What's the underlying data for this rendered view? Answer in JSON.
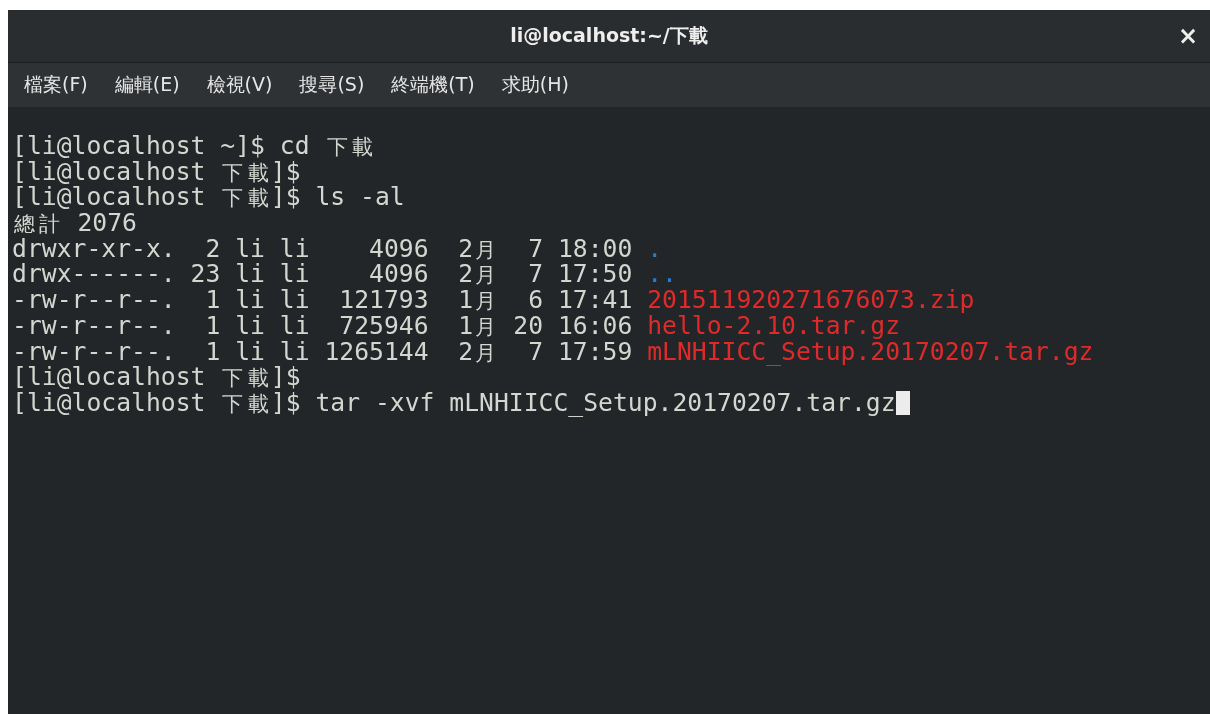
{
  "window": {
    "title": "li@localhost:~/下載",
    "close": "×"
  },
  "menu": [
    {
      "label": "檔案(F)"
    },
    {
      "label": "編輯(E)"
    },
    {
      "label": "檢視(V)"
    },
    {
      "label": "搜尋(S)"
    },
    {
      "label": "終端機(T)"
    },
    {
      "label": "求助(H)"
    }
  ],
  "terminal": {
    "lines": [
      {
        "cursor": false,
        "segments": [
          {
            "kind": "plain",
            "text": "[li@localhost ~]$ cd 下載"
          }
        ]
      },
      {
        "cursor": false,
        "segments": [
          {
            "kind": "plain",
            "text": "[li@localhost 下載]$"
          }
        ]
      },
      {
        "cursor": false,
        "segments": [
          {
            "kind": "plain",
            "text": "[li@localhost 下載]$ ls -al"
          }
        ]
      },
      {
        "cursor": false,
        "segments": [
          {
            "kind": "plain",
            "text": "總計 2076"
          }
        ]
      },
      {
        "cursor": false,
        "segments": [
          {
            "kind": "plain",
            "text": "drwxr-xr-x.  2 li li    4096  2月  7 18:00 "
          },
          {
            "kind": "directory",
            "text": "."
          }
        ]
      },
      {
        "cursor": false,
        "segments": [
          {
            "kind": "plain",
            "text": "drwx------. 23 li li    4096  2月  7 17:50 "
          },
          {
            "kind": "directory",
            "text": ".."
          }
        ]
      },
      {
        "cursor": false,
        "segments": [
          {
            "kind": "plain",
            "text": "-rw-r--r--.  1 li li  121793  1月  6 17:41 "
          },
          {
            "kind": "archive",
            "text": "201511920271676073.zip"
          }
        ]
      },
      {
        "cursor": false,
        "segments": [
          {
            "kind": "plain",
            "text": "-rw-r--r--.  1 li li  725946  1月 20 16:06 "
          },
          {
            "kind": "archive",
            "text": "hello-2.10.tar.gz"
          }
        ]
      },
      {
        "cursor": false,
        "segments": [
          {
            "kind": "plain",
            "text": "-rw-r--r--.  1 li li 1265144  2月  7 17:59 "
          },
          {
            "kind": "archive",
            "text": "mLNHIICC_Setup.20170207.tar.gz"
          }
        ]
      },
      {
        "cursor": false,
        "segments": [
          {
            "kind": "plain",
            "text": "[li@localhost 下載]$"
          }
        ]
      },
      {
        "cursor": true,
        "segments": [
          {
            "kind": "plain",
            "text": "[li@localhost 下載]$ tar -xvf mLNHIICC_Setup.20170207.tar.gz"
          }
        ]
      }
    ]
  }
}
